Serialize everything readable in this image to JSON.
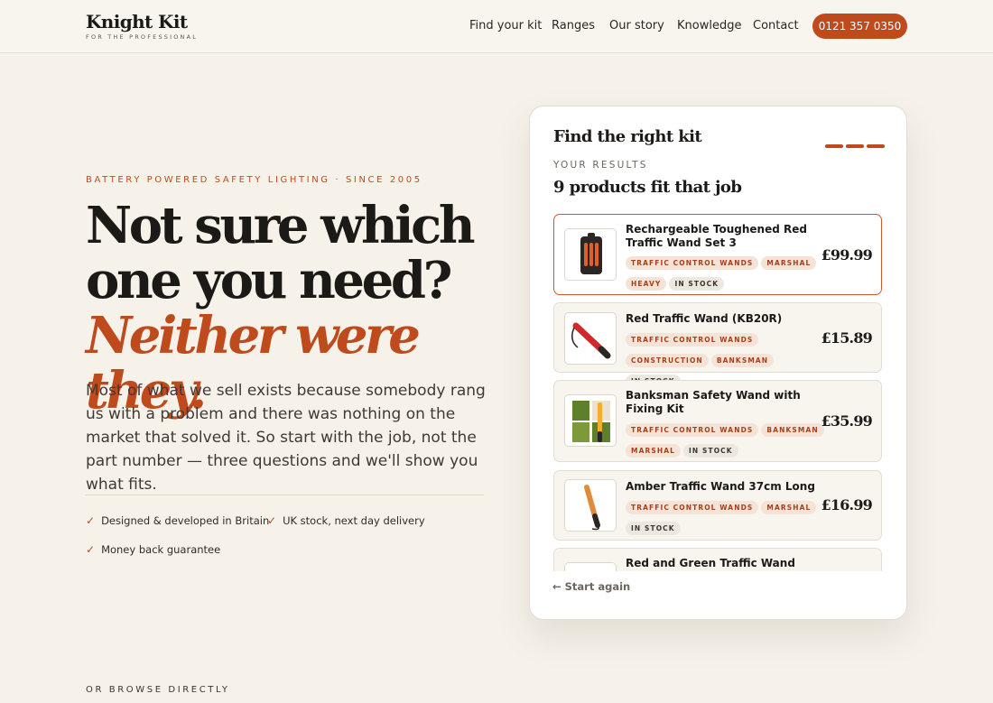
{
  "brand": {
    "name": "Knight Kit",
    "tagline": "FOR THE PROFESSIONAL"
  },
  "nav": {
    "items": [
      {
        "label": "Find your kit"
      },
      {
        "label": "Ranges"
      },
      {
        "label": "Our story"
      },
      {
        "label": "Knowledge"
      },
      {
        "label": "Contact"
      }
    ],
    "phone": "0121 357 0350"
  },
  "hero": {
    "eyebrow": "BATTERY POWERED SAFETY LIGHTING · SINCE 2005",
    "headline_main": "Not sure which one you need?",
    "headline_accent": "Neither were they.",
    "lede": "Most of what we sell exists because somebody rang us with a problem and there was nothing on the market that solved it. So start with the job, not the part number — three questions and we'll show you what fits.",
    "features": [
      {
        "label": "Designed & developed in Britain"
      },
      {
        "label": "UK stock, next day delivery"
      },
      {
        "label": "Money back guarantee"
      }
    ],
    "browse_label": "OR BROWSE DIRECTLY"
  },
  "finder": {
    "title": "Find the right kit",
    "results_label": "YOUR RESULTS",
    "results_count": "9 products fit that job",
    "start_again": "← Start again",
    "products": [
      {
        "name": "Rechargeable Toughened Red Traffic Wand Set 3",
        "tags": [
          {
            "label": "TRAFFIC CONTROL WANDS",
            "style": "orange"
          },
          {
            "label": "MARSHAL",
            "style": "orange"
          },
          {
            "label": "HEAVY",
            "style": "orange"
          },
          {
            "label": "IN STOCK",
            "style": "grey"
          }
        ],
        "price": "£99.99",
        "thumb_icon": "wand-set-icon",
        "selected": true
      },
      {
        "name": "Red Traffic Wand (KB20R)",
        "tags": [
          {
            "label": "TRAFFIC CONTROL WANDS",
            "style": "orange"
          },
          {
            "label": "CONSTRUCTION",
            "style": "orange"
          },
          {
            "label": "BANKSMAN",
            "style": "orange"
          },
          {
            "label": "IN STOCK",
            "style": "grey"
          }
        ],
        "price": "£15.89",
        "thumb_icon": "red-wand-icon",
        "selected": false
      },
      {
        "name": "Banksman Safety Wand with Fixing Kit",
        "tags": [
          {
            "label": "TRAFFIC CONTROL WANDS",
            "style": "orange"
          },
          {
            "label": "BANKSMAN",
            "style": "orange"
          },
          {
            "label": "MARSHAL",
            "style": "orange"
          },
          {
            "label": "IN STOCK",
            "style": "grey"
          }
        ],
        "price": "£35.99",
        "thumb_icon": "banksman-wand-icon",
        "selected": false
      },
      {
        "name": "Amber Traffic Wand 37cm Long",
        "tags": [
          {
            "label": "TRAFFIC CONTROL WANDS",
            "style": "orange"
          },
          {
            "label": "MARSHAL",
            "style": "orange"
          },
          {
            "label": "IN STOCK",
            "style": "grey"
          }
        ],
        "price": "£16.99",
        "thumb_icon": "amber-wand-icon",
        "selected": false
      },
      {
        "name": "Red and Green Traffic Wand Long",
        "tags": [],
        "price": "",
        "thumb_icon": "red-green-wand-icon",
        "selected": false
      }
    ]
  },
  "colors": {
    "accent": "#bf4a1c",
    "background": "#f6f2ea",
    "text": "#1c1a17"
  }
}
